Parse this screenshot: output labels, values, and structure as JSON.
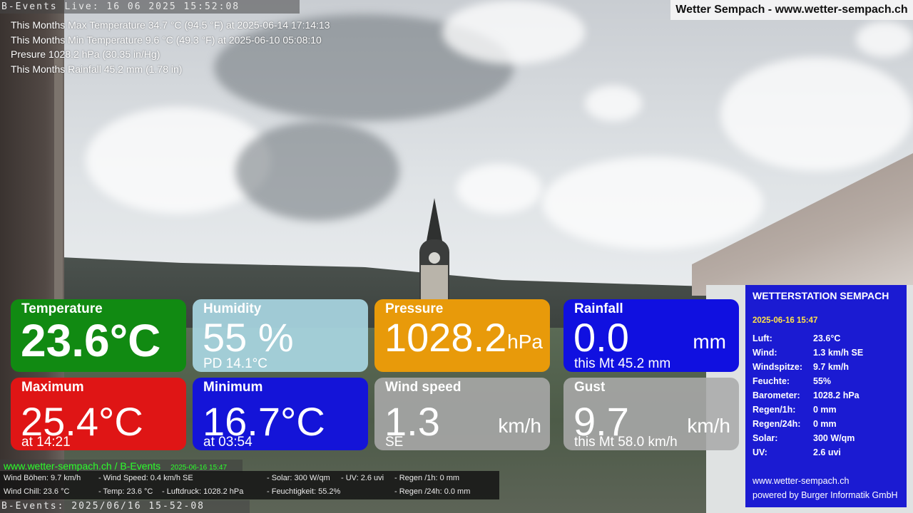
{
  "ticker_top": "B-Events Live: 16 06 2025 15:52:08",
  "site_badge": "Wetter Sempach - www.wetter-sempach.ch",
  "monthly_stats": {
    "max_temp": "This Months Max Temperature 34.7 °C (94.5 °F) at 2025-06-14 17:14:13",
    "min_temp": "This Months Min Temperature 9.6 °C (49.3 °F) at 2025-06-10 05:08:10",
    "pressure": "Presure 1028.2 hPa (30.35 in/Hg)",
    "rainfall": "This Months Rainfall 45.2 mm (1.78 in)"
  },
  "tiles": {
    "temperature": {
      "label": "Temperature",
      "value": "23.6°C"
    },
    "humidity": {
      "label": "Humidity",
      "value": "55 %",
      "sub": "PD 14.1°C"
    },
    "pressure": {
      "label": "Pressure",
      "value": "1028.2",
      "unit": "hPa"
    },
    "rainfall": {
      "label": "Rainfall",
      "value": "0.0",
      "unit": "mm",
      "sub": "this Mt 45.2 mm"
    },
    "maximum": {
      "label": "Maximum",
      "value": "25.4°C",
      "sub": "at 14:21"
    },
    "minimum": {
      "label": "Minimum",
      "value": "16.7°C",
      "sub": "at 03:54"
    },
    "wind_speed": {
      "label": "Wind speed",
      "value": "1.3",
      "unit": "km/h",
      "sub": "SE"
    },
    "gust": {
      "label": "Gust",
      "value": "9.7",
      "unit": "km/h",
      "sub": "this Mt 58.0 km/h"
    }
  },
  "station": {
    "title": "WETTERSTATION SEMPACH",
    "date": "2025-06-16 15:47",
    "rows": [
      {
        "k": "Luft:",
        "v": "23.6°C"
      },
      {
        "k": "Wind:",
        "v": "1.3 km/h  SE"
      },
      {
        "k": "Windspitze:",
        "v": "9.7 km/h"
      },
      {
        "k": "Feuchte:",
        "v": "55%"
      },
      {
        "k": "Barometer:",
        "v": "1028.2 hPa"
      },
      {
        "k": "Regen/1h:",
        "v": "0 mm"
      },
      {
        "k": "Regen/24h:",
        "v": "0 mm"
      },
      {
        "k": "Solar:",
        "v": "300 W/qm"
      },
      {
        "k": "UV:",
        "v": "2.6 uvi"
      }
    ],
    "link": "www.wetter-sempach.ch",
    "powered": "powered by Burger Informatik GmbH"
  },
  "bottom": {
    "site": "www.wetter-sempach.ch / B-Events",
    "timestamp": "2025-06-16 15:47",
    "wind_boehen": "Wind Böhen: 9.7 km/h",
    "wind_speed": "- Wind Speed: 0.4 km/h SE",
    "solar": "- Solar: 300 W/qm",
    "uv": "- UV: 2.6 uvi",
    "regen_1h": "- Regen /1h:   0 mm",
    "wind_chill": "Wind Chill: 23.6 °C",
    "temp": "- Temp: 23.6 °C",
    "luftdruck": "- Luftdruck: 1028.2 hPa",
    "feuchtigkeit": "- Feuchtigkeit: 55.2%",
    "regen_24h": "- Regen /24h: 0.0 mm"
  },
  "ticker_bottom": "B-Events: 2025/06/16 15-52-08"
}
